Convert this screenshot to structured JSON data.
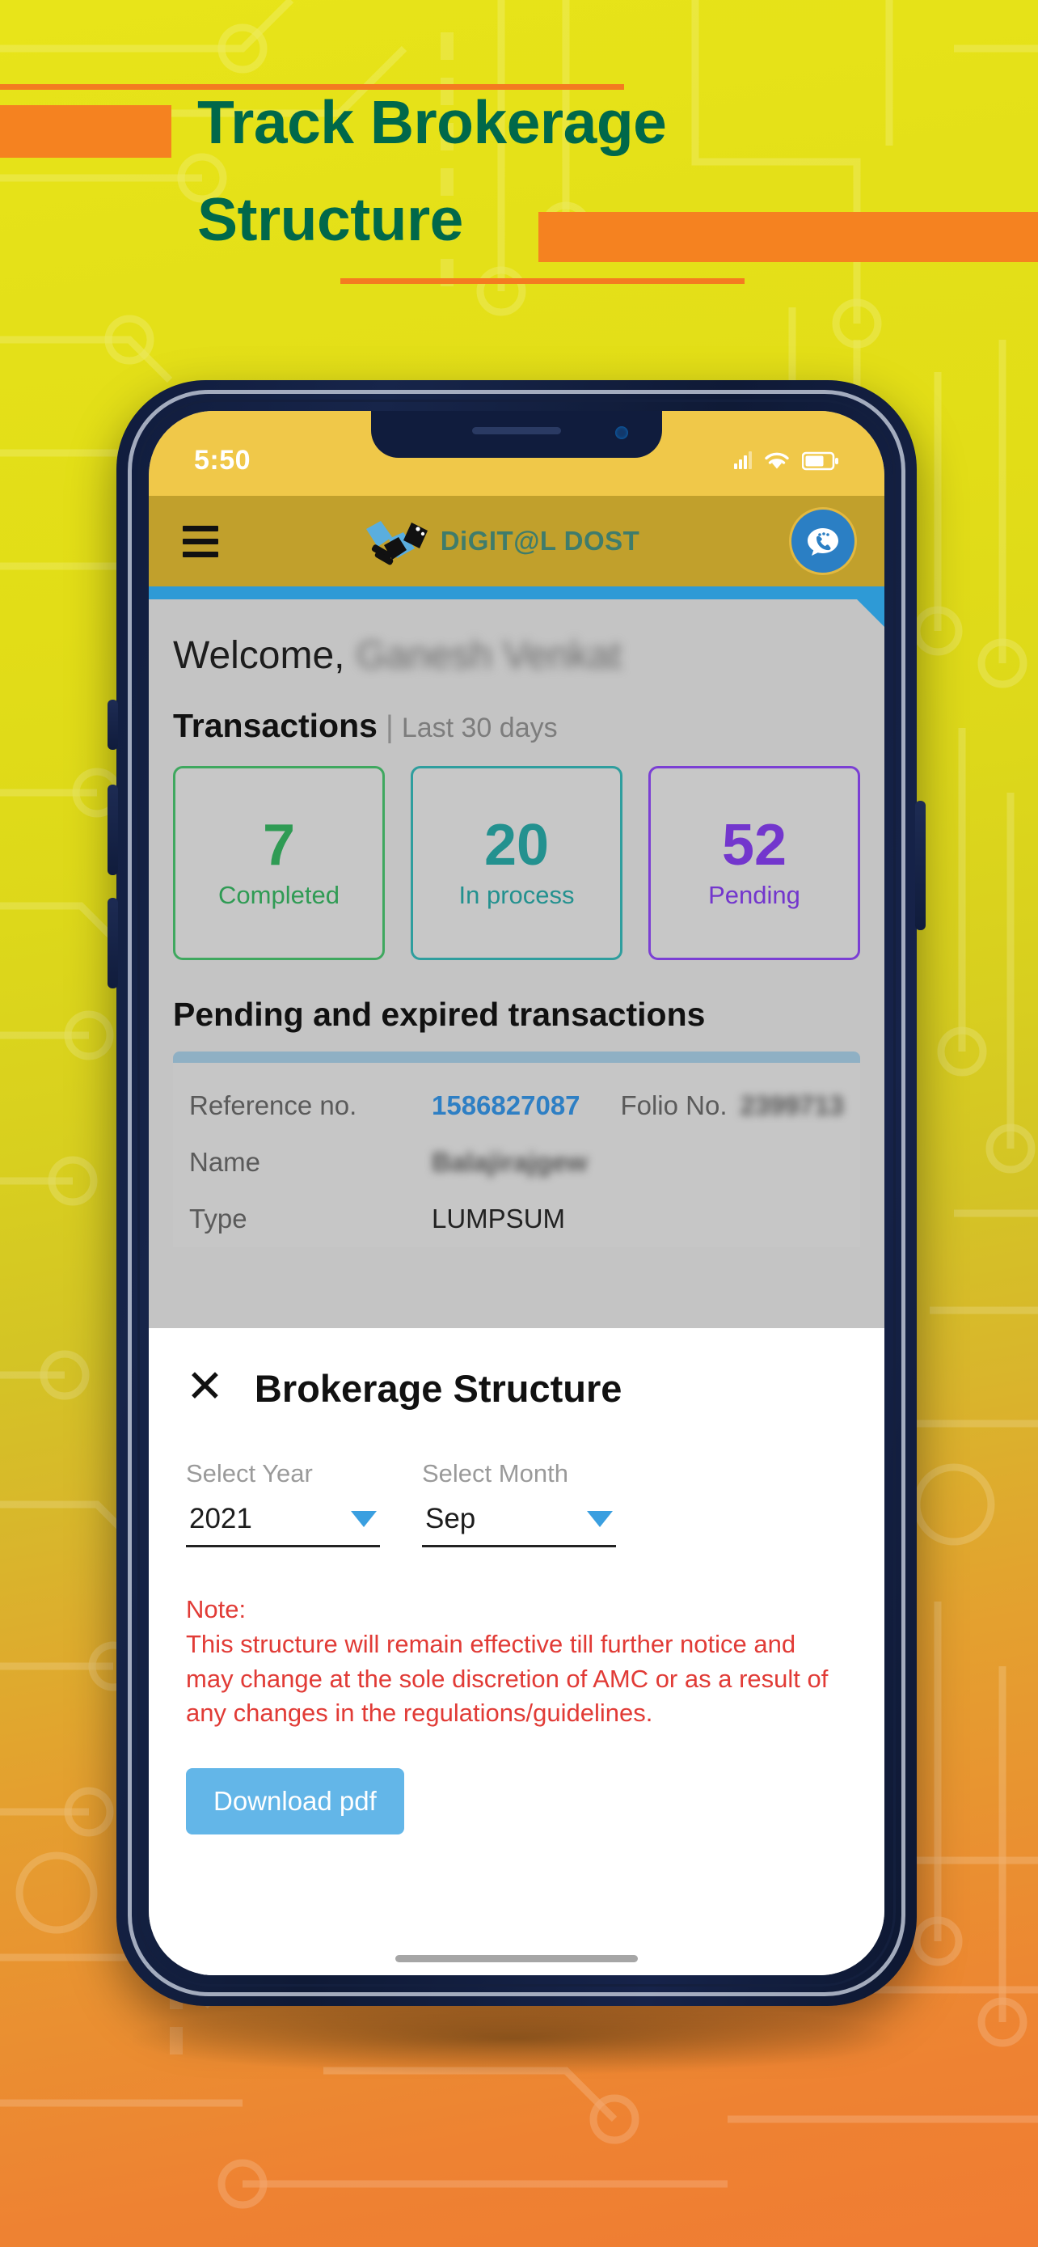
{
  "banner": {
    "title_line1": "Track Brokerage",
    "title_line2": "Structure",
    "title_color": "#00684a",
    "accent_color": "#f58220"
  },
  "phone": {
    "statusbar": {
      "time": "5:50",
      "signal_icon": "cellular-bars-icon",
      "wifi_icon": "wifi-icon",
      "battery_icon": "battery-icon"
    },
    "appheader": {
      "menu_icon": "hamburger-menu-icon",
      "logo_icon": "handshake-logo-icon",
      "logo_text": "DiGIT@L DOST",
      "chat_icon": "chat-support-icon"
    },
    "main": {
      "welcome_prefix": "Welcome,",
      "welcome_name": "Ganesh Venkat",
      "transactions_title": "Transactions",
      "transactions_separator": "|",
      "transactions_period": "Last 30 days",
      "cards": [
        {
          "value": "7",
          "label": "Completed",
          "color": "#2f9b54"
        },
        {
          "value": "20",
          "label": "In process",
          "color": "#23918f"
        },
        {
          "value": "52",
          "label": "Pending",
          "color": "#7336cd"
        }
      ],
      "pending_title": "Pending and expired transactions",
      "table": {
        "rows": [
          {
            "label": "Reference no.",
            "value": "1586827087",
            "style": "link",
            "label2": "Folio No.",
            "value2": "2399713"
          },
          {
            "label": "Name",
            "value": "Balajirajgew",
            "style": "blur"
          },
          {
            "label": "Type",
            "value": "LUMPSUM",
            "style": "plain"
          }
        ]
      }
    },
    "sheet": {
      "close_icon": "close-x-icon",
      "title": "Brokerage Structure",
      "year_label": "Select Year",
      "year_value": "2021",
      "month_label": "Select Month",
      "month_value": "Sep",
      "chevron_icon": "chevron-down-icon",
      "note_heading": "Note:",
      "note_line1": "This structure will remain effective till further notice and",
      "note_line2": "may change at the sole discretion of AMC or as a result of",
      "note_line3": "any changes in the regulations/guidelines.",
      "note_color": "#e13b36",
      "download_label": "Download pdf",
      "download_color": "#63b6e8"
    }
  }
}
